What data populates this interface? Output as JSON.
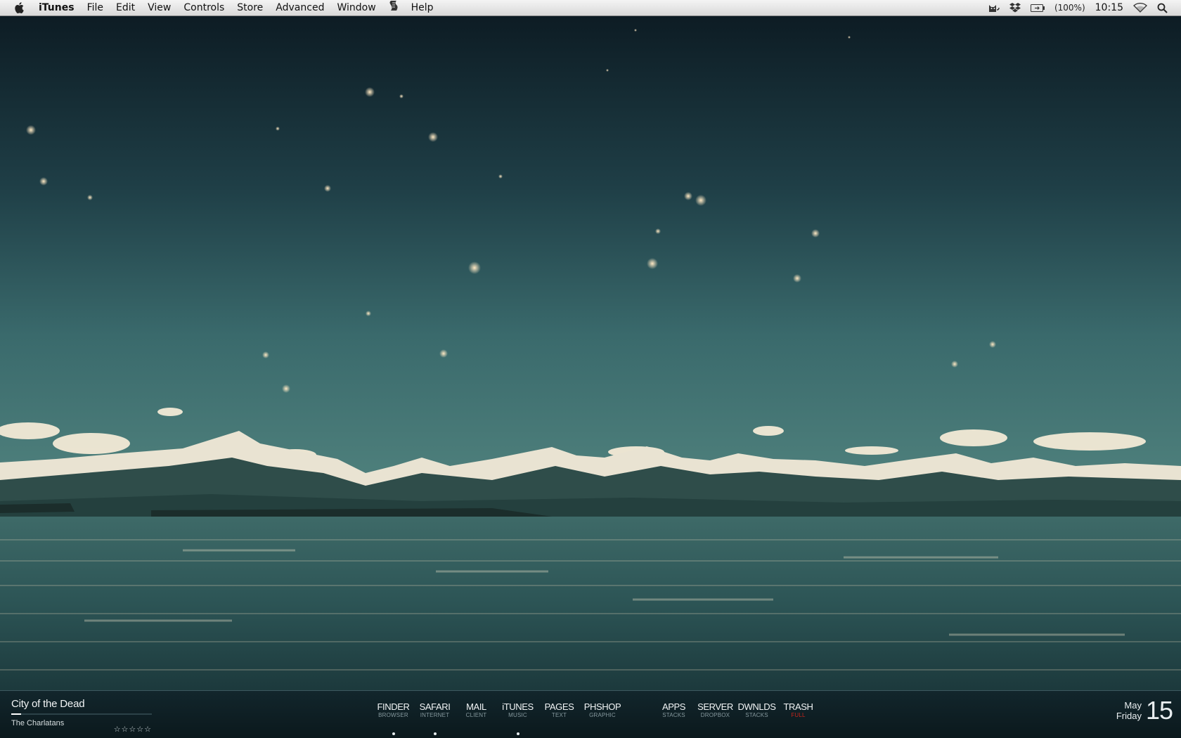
{
  "menubar": {
    "apple_icon": "apple-icon",
    "app_name": "iTunes",
    "menus": [
      "File",
      "Edit",
      "View",
      "Controls",
      "Store",
      "Advanced",
      "Window",
      "Script",
      "Help"
    ],
    "status": {
      "cat_icon": "cat-icon",
      "dropbox_icon": "dropbox-icon",
      "battery_icon": "battery-icon",
      "battery_text": "(100%)",
      "time": "10:15",
      "wifi_icon": "wifi-icon",
      "spotlight_icon": "spotlight-icon"
    }
  },
  "now_playing": {
    "title": "City of the Dead",
    "artist": "The Charlatans",
    "rating": "☆☆☆☆☆",
    "progress": 0.07
  },
  "dock": {
    "items": [
      {
        "label": "FINDER",
        "sub": "BROWSER",
        "running": true
      },
      {
        "label": "SAFARI",
        "sub": "INTERNET",
        "running": true
      },
      {
        "label": "MAIL",
        "sub": "CLIENT",
        "running": false
      },
      {
        "label": "iTUNES",
        "sub": "MUSIC",
        "running": true
      },
      {
        "label": "PAGES",
        "sub": "TEXT",
        "running": false
      },
      {
        "label": "PHSHOP",
        "sub": "GRAPHIC",
        "running": false
      },
      {
        "label": "APPS",
        "sub": "STACKS",
        "running": false
      },
      {
        "label": "SERVER",
        "sub": "DROPBOX",
        "running": false
      },
      {
        "label": "DWNLDS",
        "sub": "STACKS",
        "running": false
      },
      {
        "label": "TRASH",
        "sub": "FULL",
        "running": false,
        "alert": true
      }
    ]
  },
  "date": {
    "month": "May",
    "weekday": "Friday",
    "day": "15"
  },
  "colors": {
    "sky_top": "#0d1c24",
    "sky_bottom": "#3a6a6c",
    "water": "#2c5455",
    "trash_alert": "#c4241b"
  }
}
